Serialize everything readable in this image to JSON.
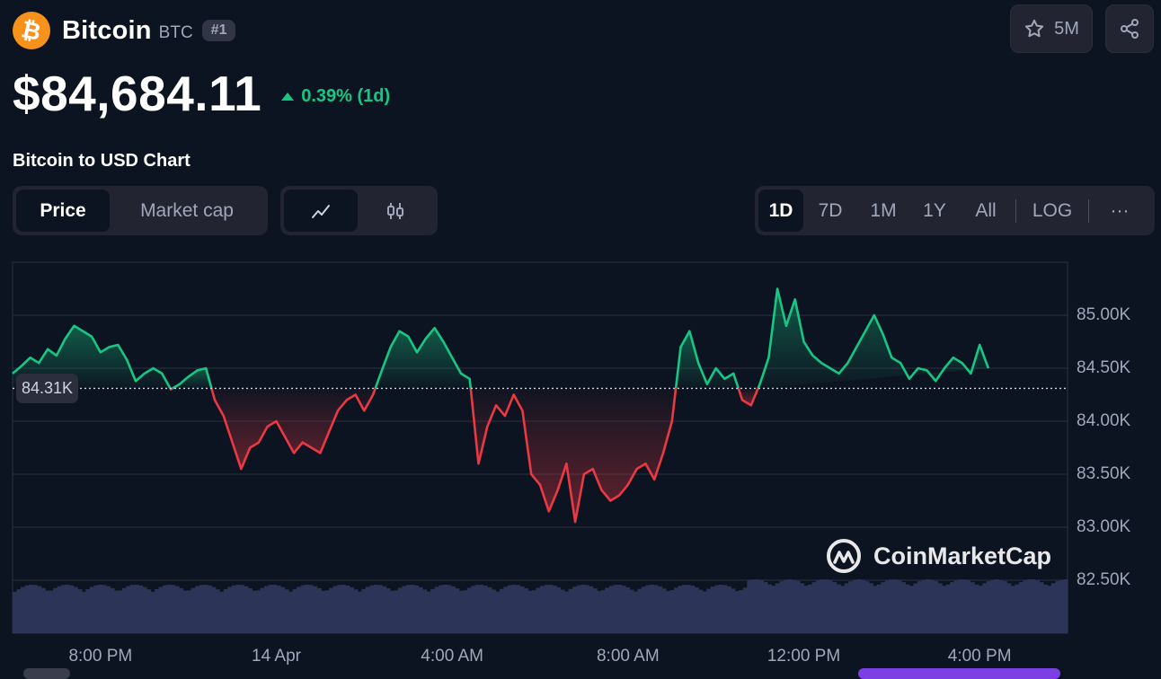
{
  "coin": {
    "logo_glyph": "₿",
    "name": "Bitcoin",
    "symbol": "BTC",
    "rank": "#1"
  },
  "actions": {
    "watchlist_icon": "star-icon",
    "watchlist_count": "5M",
    "share_icon": "share-icon"
  },
  "price": {
    "value": "$84,684.11",
    "change": "0.39% (1d)",
    "change_color": "#16c784"
  },
  "chart_title": "Bitcoin to USD Chart",
  "tabs": {
    "metric": [
      "Price",
      "Market cap"
    ],
    "metric_selected": "Price",
    "chart_type_icons": [
      "line-chart-icon",
      "candlestick-icon"
    ],
    "chart_type_selected": "line-chart-icon",
    "ranges": [
      "1D",
      "7D",
      "1M",
      "1Y",
      "All"
    ],
    "range_selected": "1D",
    "log": "LOG",
    "more": "···"
  },
  "reference_price_label": "84.31K",
  "watermark": "CoinMarketCap",
  "colors": {
    "background": "#0d1421",
    "up": "#16c784",
    "down": "#ea3943",
    "volume": "#2c3458"
  },
  "chart_data": {
    "type": "area",
    "title": "",
    "xlabel": "",
    "ylabel": "",
    "ylim": [
      82.0,
      85.5
    ],
    "y_unit": "K USD",
    "y_ticks": [
      "85.00K",
      "84.50K",
      "84.00K",
      "83.50K",
      "83.00K",
      "82.50K"
    ],
    "y_tick_values": [
      85.0,
      84.5,
      84.0,
      83.5,
      83.0,
      82.5
    ],
    "x_tick_labels": [
      "8:00 PM",
      "14 Apr",
      "4:00 AM",
      "8:00 AM",
      "12:00 PM",
      "4:00 PM"
    ],
    "x_tick_hours": [
      2,
      6,
      10,
      14,
      18,
      22
    ],
    "xlim_hours": [
      0,
      24
    ],
    "baseline": 84.31,
    "series": [
      {
        "x_hours": [
          0.0,
          0.2,
          0.4,
          0.6,
          0.8,
          1.0,
          1.2,
          1.4,
          1.6,
          1.8,
          2.0,
          2.2,
          2.4,
          2.6,
          2.8,
          3.0,
          3.2,
          3.4,
          3.6,
          3.8,
          4.0,
          4.2,
          4.4,
          4.6,
          4.8,
          5.0,
          5.2,
          5.4,
          5.6,
          5.8,
          6.0,
          6.2,
          6.4,
          6.6,
          6.8,
          7.0,
          7.2,
          7.4,
          7.6,
          7.8,
          8.0,
          8.2,
          8.4,
          8.6,
          8.8,
          9.0,
          9.2,
          9.4,
          9.6,
          9.8,
          10.0,
          10.2,
          10.4,
          10.6,
          10.8,
          11.0,
          11.2,
          11.4,
          11.6,
          11.8,
          12.0,
          12.2,
          12.4,
          12.6,
          12.8,
          13.0,
          13.2,
          13.4,
          13.6,
          13.8,
          14.0,
          14.2,
          14.4,
          14.6,
          14.8,
          15.0,
          15.2,
          15.4,
          15.6,
          15.8,
          16.0,
          16.2,
          16.4,
          16.6,
          16.8,
          17.0,
          17.2,
          17.4,
          17.6,
          17.8,
          18.0,
          18.2,
          18.4,
          18.6,
          18.8,
          19.0,
          19.2,
          19.4,
          19.6,
          19.8,
          20.0,
          20.2,
          20.4,
          20.6,
          20.8,
          21.0,
          21.2,
          21.4,
          21.6,
          21.8,
          22.0,
          22.2,
          22.4,
          22.6,
          22.8,
          23.0,
          23.2,
          23.4,
          23.6,
          23.8,
          24.0
        ],
        "values": [
          84.45,
          84.52,
          84.6,
          84.55,
          84.68,
          84.62,
          84.78,
          84.9,
          84.85,
          84.8,
          84.65,
          84.7,
          84.72,
          84.58,
          84.38,
          84.45,
          84.5,
          84.45,
          84.3,
          84.35,
          84.42,
          84.48,
          84.5,
          84.2,
          84.05,
          83.8,
          83.55,
          83.75,
          83.8,
          83.95,
          84.0,
          83.85,
          83.7,
          83.8,
          83.75,
          83.7,
          83.9,
          84.1,
          84.2,
          84.25,
          84.1,
          84.25,
          84.48,
          84.7,
          84.85,
          84.8,
          84.65,
          84.78,
          84.88,
          84.75,
          84.6,
          84.45,
          84.4,
          83.6,
          83.95,
          84.15,
          84.05,
          84.25,
          84.1,
          83.5,
          83.4,
          83.15,
          83.35,
          83.6,
          83.05,
          83.5,
          83.55,
          83.35,
          83.25,
          83.3,
          83.4,
          83.55,
          83.6,
          83.45,
          83.7,
          84.0,
          84.7,
          84.85,
          84.55,
          84.35,
          84.5,
          84.4,
          84.45,
          84.2,
          84.15,
          84.35,
          84.6,
          85.25,
          84.9,
          85.15,
          84.75,
          84.62,
          84.55,
          84.5,
          84.45,
          84.55,
          84.7,
          84.85,
          85.0,
          84.82,
          84.6,
          84.55,
          84.4,
          84.5,
          84.48,
          84.38,
          84.5,
          84.6,
          84.55,
          84.45,
          84.72,
          84.5
        ],
        "color": "#16c784"
      }
    ],
    "grid": true,
    "legend": "none"
  }
}
